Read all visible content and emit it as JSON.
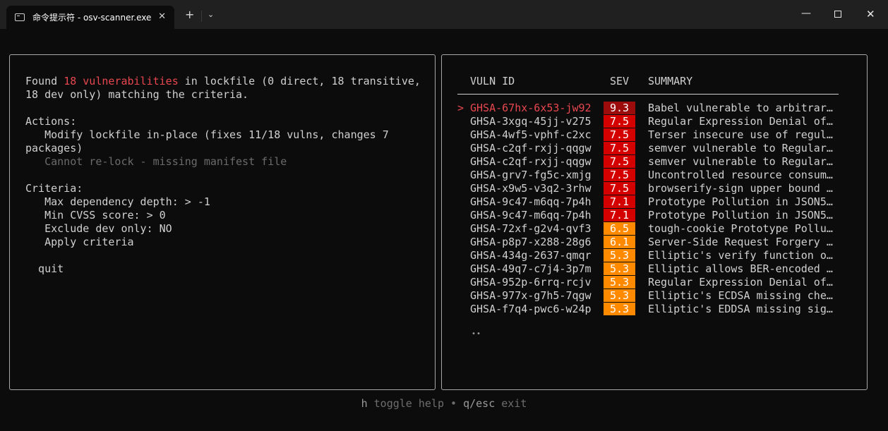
{
  "window": {
    "tab_title": "命令提示符 - osv-scanner.exe",
    "tab_close": "✕",
    "new_tab": "+",
    "dropdown": "⌄",
    "minimize": "—",
    "close": "✕"
  },
  "left": {
    "found_prefix": "Found ",
    "found_count": "18 vulnerabilities",
    "found_suffix": " in lockfile (0 direct, 18 transitive,",
    "found_line2": "18 dev only) matching the criteria.",
    "actions_heading": "Actions:",
    "action1_line1": "   Modify lockfile in-place (fixes 11/18 vulns, changes 7",
    "action1_line2": "packages)",
    "action2": "   Cannot re-lock - missing manifest file",
    "criteria_heading": "Criteria:",
    "criteria": [
      "   Max dependency depth: > -1",
      "   Min CVSS score: > 0",
      "   Exclude dev only: NO",
      "   Apply criteria"
    ],
    "quit": "  quit"
  },
  "right": {
    "headers": {
      "id": "VULN ID",
      "sev": "SEV",
      "summary": "SUMMARY"
    },
    "cursor": ">",
    "colors": {
      "critical_selected": "#9c0c0c",
      "high": "#d40000",
      "medium": "#ff8a00"
    },
    "rows": [
      {
        "id": "GHSA-67hx-6x53-jw92",
        "sev": "9.3",
        "summary": "Babel vulnerable to arbitrar…",
        "level": "critical_selected",
        "selected": true
      },
      {
        "id": "GHSA-3xgq-45jj-v275",
        "sev": "7.5",
        "summary": "Regular Expression Denial of…",
        "level": "high"
      },
      {
        "id": "GHSA-4wf5-vphf-c2xc",
        "sev": "7.5",
        "summary": "Terser insecure use of regul…",
        "level": "high"
      },
      {
        "id": "GHSA-c2qf-rxjj-qqgw",
        "sev": "7.5",
        "summary": "semver vulnerable to Regular…",
        "level": "high"
      },
      {
        "id": "GHSA-c2qf-rxjj-qqgw",
        "sev": "7.5",
        "summary": "semver vulnerable to Regular…",
        "level": "high"
      },
      {
        "id": "GHSA-grv7-fg5c-xmjg",
        "sev": "7.5",
        "summary": "Uncontrolled resource consum…",
        "level": "high"
      },
      {
        "id": "GHSA-x9w5-v3q2-3rhw",
        "sev": "7.5",
        "summary": "browserify-sign upper bound …",
        "level": "high"
      },
      {
        "id": "GHSA-9c47-m6qq-7p4h",
        "sev": "7.1",
        "summary": "Prototype Pollution in JSON5…",
        "level": "high"
      },
      {
        "id": "GHSA-9c47-m6qq-7p4h",
        "sev": "7.1",
        "summary": "Prototype Pollution in JSON5…",
        "level": "high"
      },
      {
        "id": "GHSA-72xf-g2v4-qvf3",
        "sev": "6.5",
        "summary": "tough-cookie Prototype Pollu…",
        "level": "medium"
      },
      {
        "id": "GHSA-p8p7-x288-28g6",
        "sev": "6.1",
        "summary": "Server-Side Request Forgery …",
        "level": "medium"
      },
      {
        "id": "GHSA-434g-2637-qmqr",
        "sev": "5.3",
        "summary": "Elliptic's verify function o…",
        "level": "medium"
      },
      {
        "id": "GHSA-49q7-c7j4-3p7m",
        "sev": "5.3",
        "summary": "Elliptic allows BER-encoded …",
        "level": "medium"
      },
      {
        "id": "GHSA-952p-6rrq-rcjv",
        "sev": "5.3",
        "summary": "Regular Expression Denial of…",
        "level": "medium"
      },
      {
        "id": "GHSA-977x-g7h5-7qgw",
        "sev": "5.3",
        "summary": "Elliptic's ECDSA missing che…",
        "level": "medium"
      },
      {
        "id": "GHSA-f7q4-pwc6-w24p",
        "sev": "5.3",
        "summary": "Elliptic's EDDSA missing sig…",
        "level": "medium"
      }
    ],
    "pager": "••"
  },
  "help": {
    "key1": "h",
    "text1": " toggle help ",
    "sep": "•",
    "key2": " q/esc",
    "text2": " exit"
  }
}
